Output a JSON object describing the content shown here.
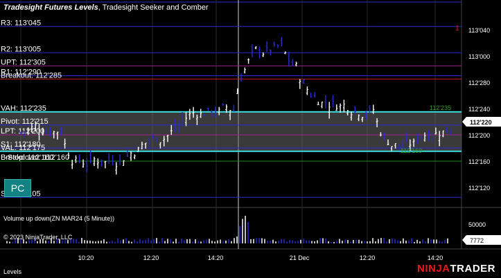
{
  "window": {
    "title_bold": "Tradesight Futures Levels",
    "title_rest": ", Tradesight Seeker and Comber"
  },
  "levels": [
    {
      "label": "R3: 113'045",
      "price": 113.140625,
      "color": "#2a2ad6"
    },
    {
      "label": "R2: 113'005",
      "price": 113.015625,
      "color": "#2a2ad6"
    },
    {
      "label": "UPT: 112'305",
      "price": 112.953125,
      "color": "#a0248a"
    },
    {
      "label": "R1: 112'290",
      "price": 112.90625,
      "color": "#2a2ad6"
    },
    {
      "label": "Breakout: 112'285",
      "price": 112.890625,
      "color": "#d01a1a"
    },
    {
      "label": "VAH: 112'235",
      "price": 112.734375,
      "color": "#3ce0e0"
    },
    {
      "label": "Pivot: 112'215",
      "price": 112.671875,
      "color": "#2a2ad6"
    },
    {
      "label": "LPT: 112'200",
      "price": 112.625,
      "color": "#a0248a"
    },
    {
      "label": "S1: 112'180",
      "price": 112.5625,
      "color": "#2a2ad6"
    },
    {
      "label": "VAL: 112'175",
      "price": 112.546875,
      "color": "#3ce0e0"
    },
    {
      "label": "L-Stop: 112'160",
      "price": 112.5,
      "color": "#2a2ad6"
    },
    {
      "label": "Breakdown: 112'160",
      "price": 112.5,
      "color": "#1e8a1e"
    },
    {
      "label": "S2: 112'105",
      "price": 112.328125,
      "color": "#2a2ad6"
    }
  ],
  "price_axis": [
    "113'040",
    "113'000",
    "112'280",
    "112'240",
    "112'200",
    "112'160",
    "112'120"
  ],
  "last_price": "112'220",
  "indicator_marker": "1",
  "vah_right_label": "112'235",
  "breakdown_right_label": "112'160",
  "pc_badge": "PC",
  "volume": {
    "title": "Volume up down(ZN MAR24 (5 Minute))",
    "axis_label": "50000",
    "last_volume": "7772"
  },
  "copyright": "© 2023 NinjaTrader, LLC",
  "time_axis": [
    "10:20",
    "12:20",
    "14:20",
    "21 Dec",
    "12:20",
    "14:20"
  ],
  "lower_pane_label": "Levels",
  "logo": {
    "ninja": "NINJA",
    "trader": "TRADER"
  },
  "colors": {
    "up_bar": "#ffffff",
    "down_bar": "#2a2ad6",
    "value_area": "#6a6a6a",
    "grid": "#2a2a2a"
  }
}
